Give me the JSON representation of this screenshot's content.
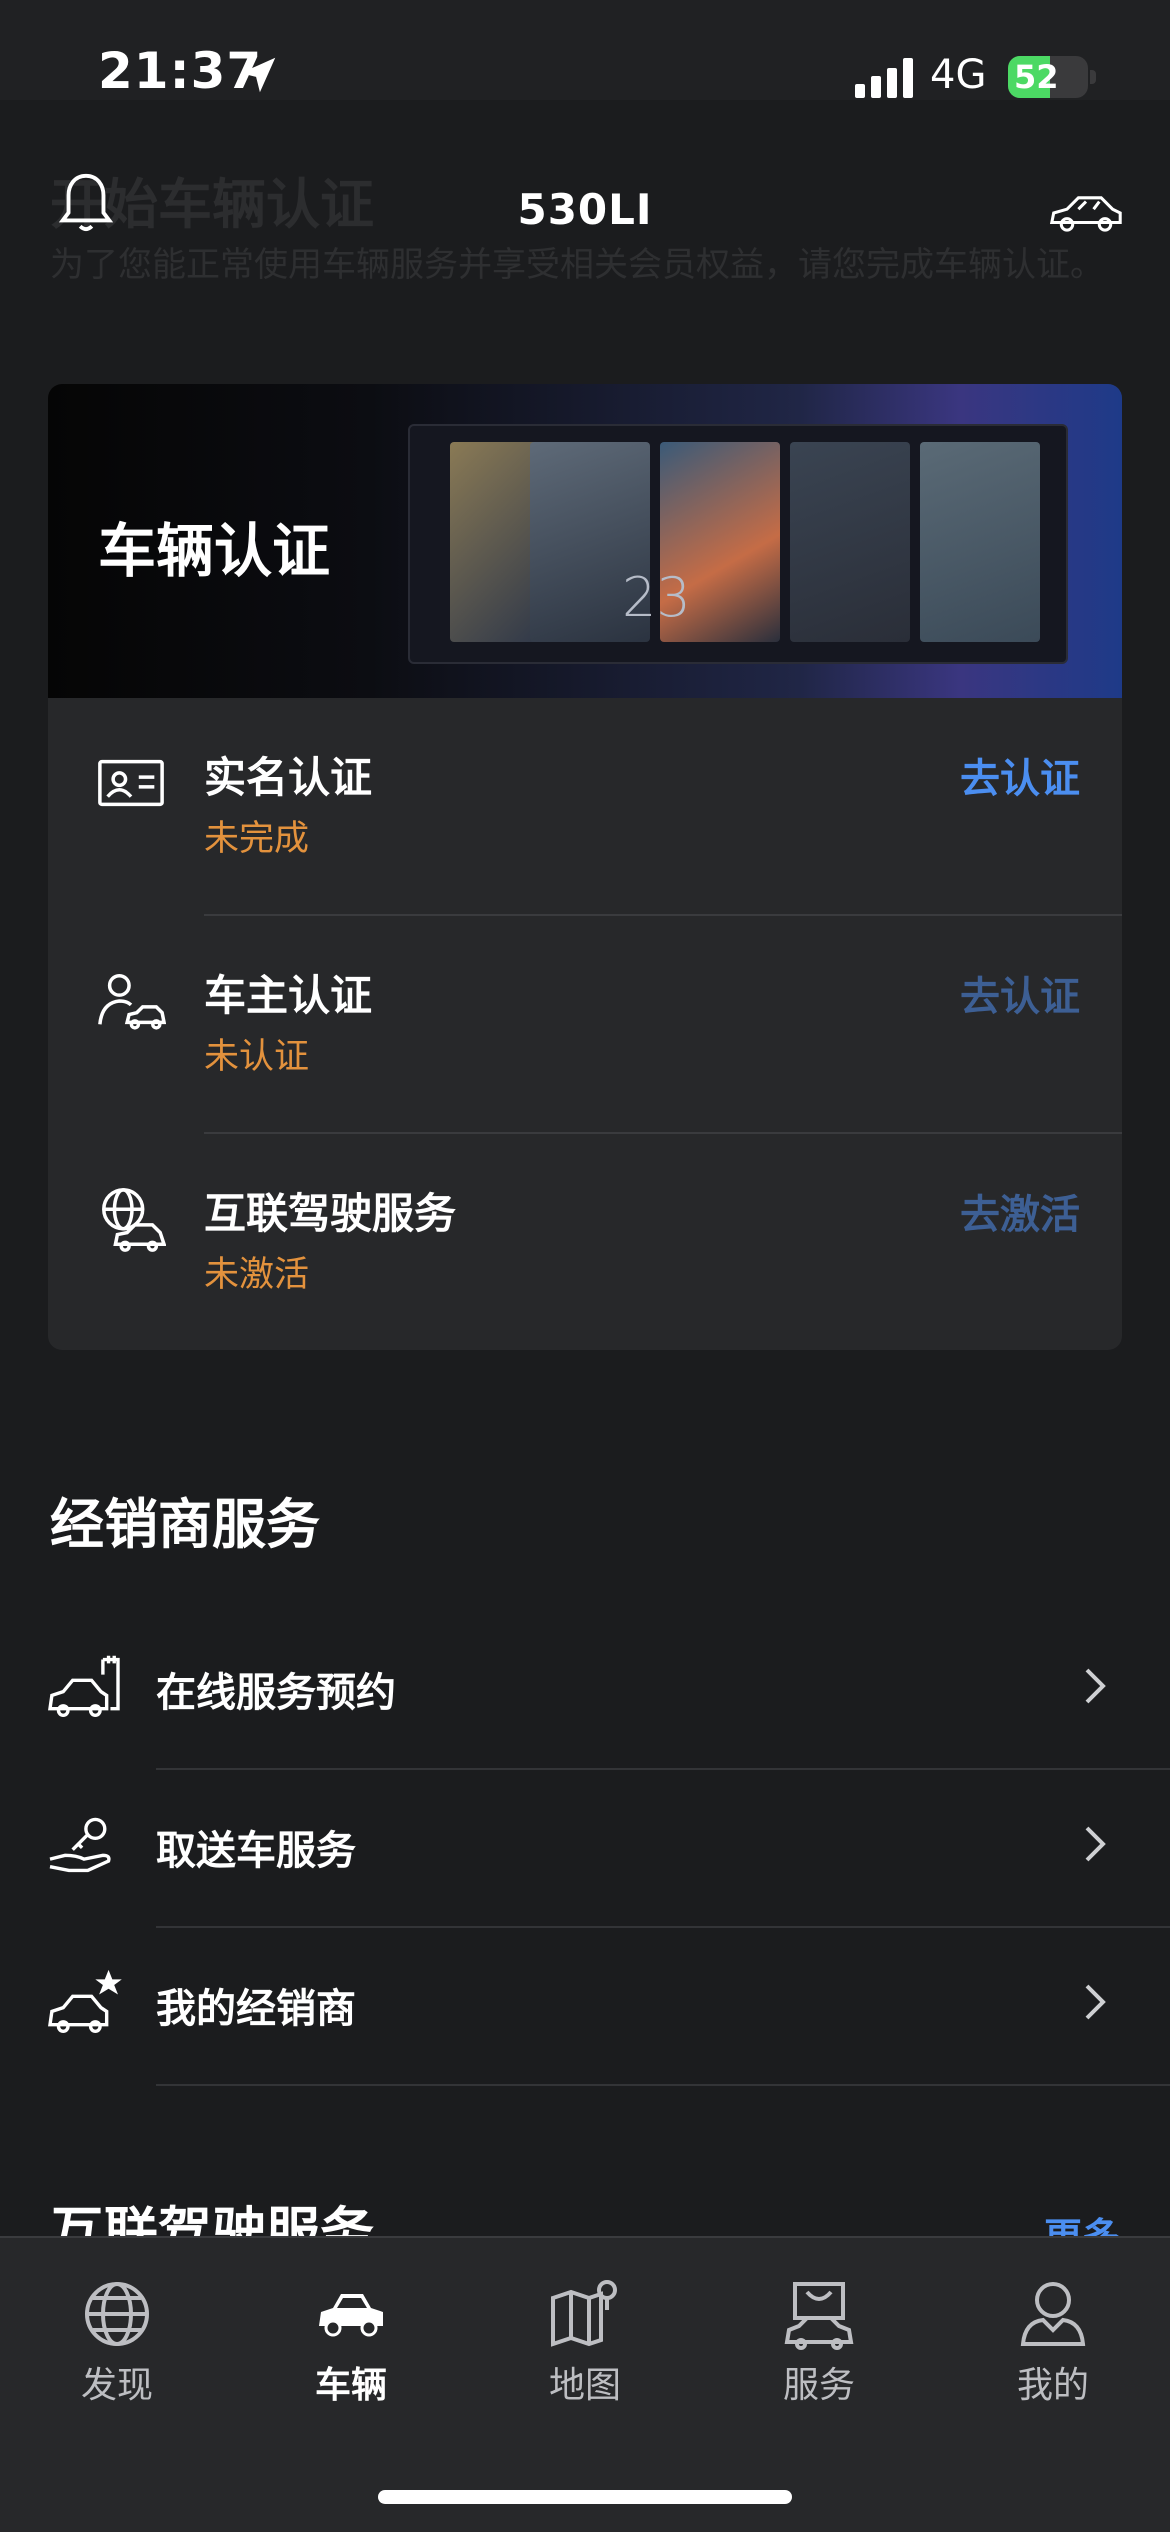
{
  "status_bar": {
    "time": "21:37",
    "carrier": "4G",
    "battery_percent": "52",
    "battery_level": 0.52
  },
  "header": {
    "title": "530LI",
    "background_heading": "开始车辆认证",
    "background_text": "为了您能正常使用车辆服务并享受相关会员权益，请您完成车辆认证。"
  },
  "auth_card": {
    "banner_title": "车辆认证",
    "banner_display_number": "23",
    "items": [
      {
        "title": "实名认证",
        "status": "未完成",
        "action": "去认证",
        "action_color": "#4b8ef0",
        "icon": "id-card-icon"
      },
      {
        "title": "车主认证",
        "status": "未认证",
        "action": "去认证",
        "action_color": "#3d5f94",
        "icon": "owner-car-icon"
      },
      {
        "title": "互联驾驶服务",
        "status": "未激活",
        "action": "去激活",
        "action_color": "#3d5f94",
        "icon": "globe-car-icon"
      }
    ]
  },
  "dealer_services": {
    "title": "经销商服务",
    "items": [
      {
        "label": "在线服务预约",
        "icon": "service-appointment-icon"
      },
      {
        "label": "取送车服务",
        "icon": "key-handover-icon"
      },
      {
        "label": "我的经销商",
        "icon": "favorite-dealer-icon"
      }
    ]
  },
  "connected_drive": {
    "title": "互联驾驶服务",
    "more": "更多"
  },
  "tab_bar": {
    "tabs": [
      {
        "label": "发现",
        "icon": "globe-icon",
        "active": false
      },
      {
        "label": "车辆",
        "icon": "car-icon",
        "active": true
      },
      {
        "label": "地图",
        "icon": "map-icon",
        "active": false
      },
      {
        "label": "服务",
        "icon": "service-bag-icon",
        "active": false
      },
      {
        "label": "我的",
        "icon": "profile-icon",
        "active": false
      }
    ]
  },
  "colors": {
    "accent_blue": "#4b8ef0",
    "status_orange": "#e3923d",
    "background": "#1b1c1e",
    "card": "#27282a"
  }
}
